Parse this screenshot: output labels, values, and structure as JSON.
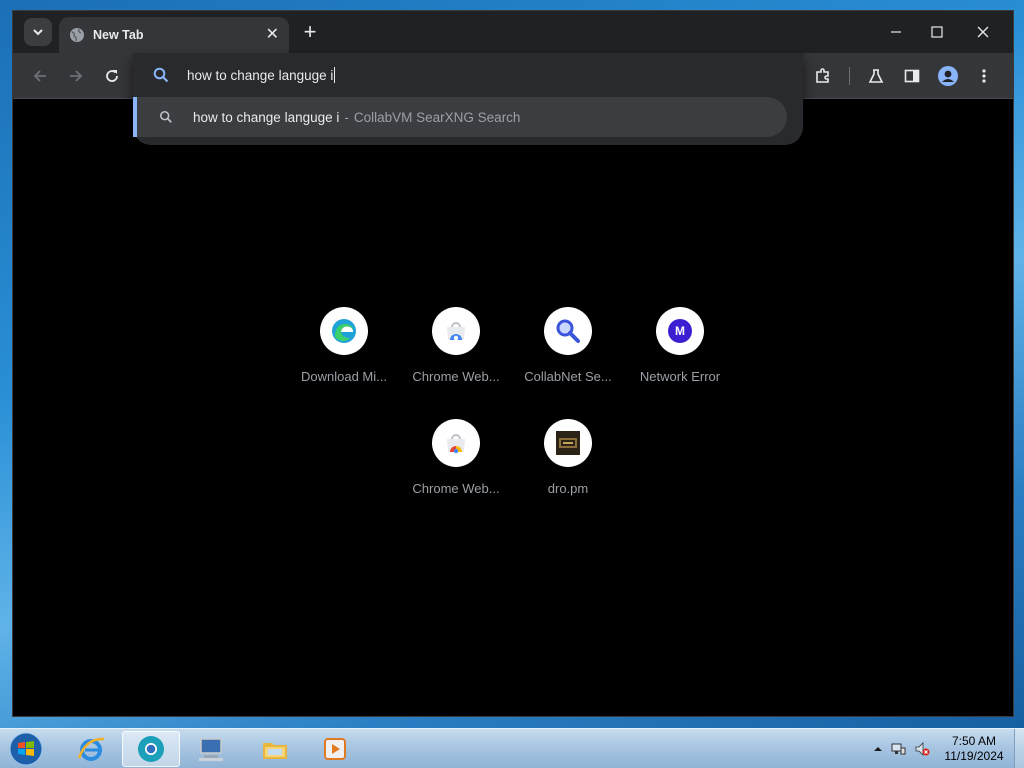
{
  "browser": {
    "tab": {
      "title": "New Tab"
    },
    "omnibox": {
      "query": "how to change languge i",
      "suggestion": {
        "text": "how to change languge i",
        "separator": "-",
        "description": "CollabVM SearXNG Search"
      }
    },
    "shortcuts": [
      {
        "label": "Download Mi...",
        "icon": "edge-icon"
      },
      {
        "label": "Chrome Web...",
        "icon": "chrome-web-store-icon"
      },
      {
        "label": "CollabNet Se...",
        "icon": "magnifier-icon"
      },
      {
        "label": "Network Error",
        "icon": "m-letter-icon",
        "letter": "M"
      },
      {
        "label": "Chrome Web...",
        "icon": "chrome-web-store-icon"
      },
      {
        "label": "dro.pm",
        "icon": "dro-pm-icon"
      }
    ]
  },
  "taskbar": {
    "time": "7:50 AM",
    "date": "11/19/2024"
  },
  "colors": {
    "accent": "#8ab4f8",
    "chrome_dark": "#35363a",
    "network_error_badge": "#3b1fd1"
  }
}
